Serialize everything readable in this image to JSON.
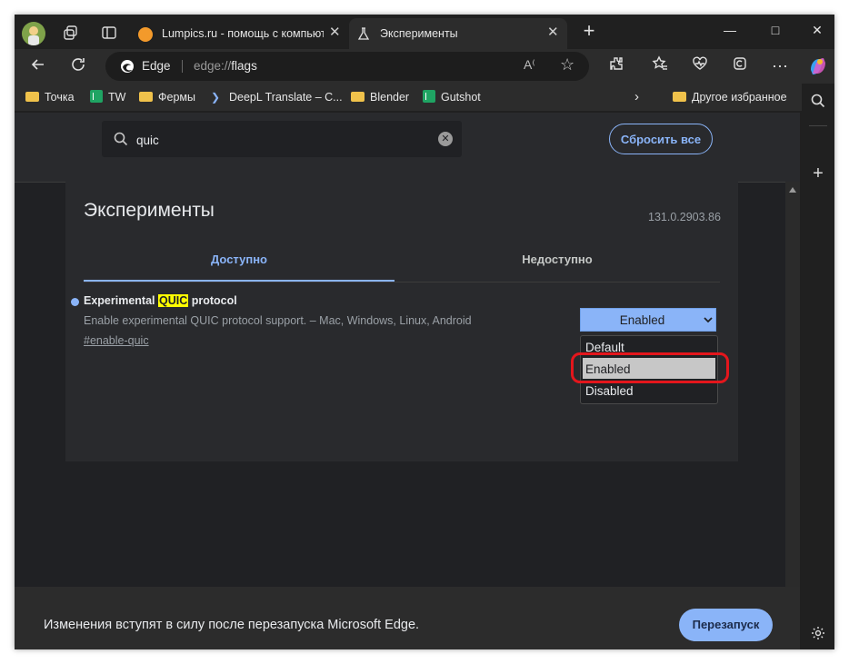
{
  "tabs": [
    {
      "title": "Lumpics.ru - помощь с компьюте",
      "active": false
    },
    {
      "title": "Эксперименты",
      "active": true
    }
  ],
  "new_tab_symbol": "+",
  "toolbar": {
    "site_name": "Edge",
    "url_prefix": "edge://",
    "url_path": "flags"
  },
  "bookmarks": [
    {
      "label": "Точка",
      "icon": "folder-icon"
    },
    {
      "label": "TW",
      "icon": "sheets-icon"
    },
    {
      "label": "Фермы",
      "icon": "folder-icon"
    },
    {
      "label": "DeepL Translate – C...",
      "icon": "deepl-icon"
    },
    {
      "label": "Blender",
      "icon": "folder-icon"
    },
    {
      "label": "Gutshot",
      "icon": "sheets-icon"
    }
  ],
  "other_favorites": "Другое избранное",
  "search": {
    "value": "quic"
  },
  "reset_label": "Сбросить все",
  "page_title": "Эксперименты",
  "version": "131.0.2903.86",
  "content_tabs": [
    {
      "label": "Доступно",
      "active": true
    },
    {
      "label": "Недоступно",
      "active": false
    }
  ],
  "flag": {
    "title_before": "Experimental ",
    "title_highlight": "QUIC",
    "title_after": " protocol",
    "description": "Enable experimental QUIC protocol support. – Mac, Windows, Linux, Android",
    "link": "#enable-quic",
    "selected": "Enabled",
    "options": [
      "Default",
      "Enabled",
      "Disabled"
    ]
  },
  "footer": {
    "message": "Изменения вступят в силу после перезапуска Microsoft Edge.",
    "relaunch_label": "Перезапуск"
  },
  "colors": {
    "accent": "#8ab4f8",
    "highlight": "#ffff00",
    "annotation_ring": "#e4161c"
  }
}
